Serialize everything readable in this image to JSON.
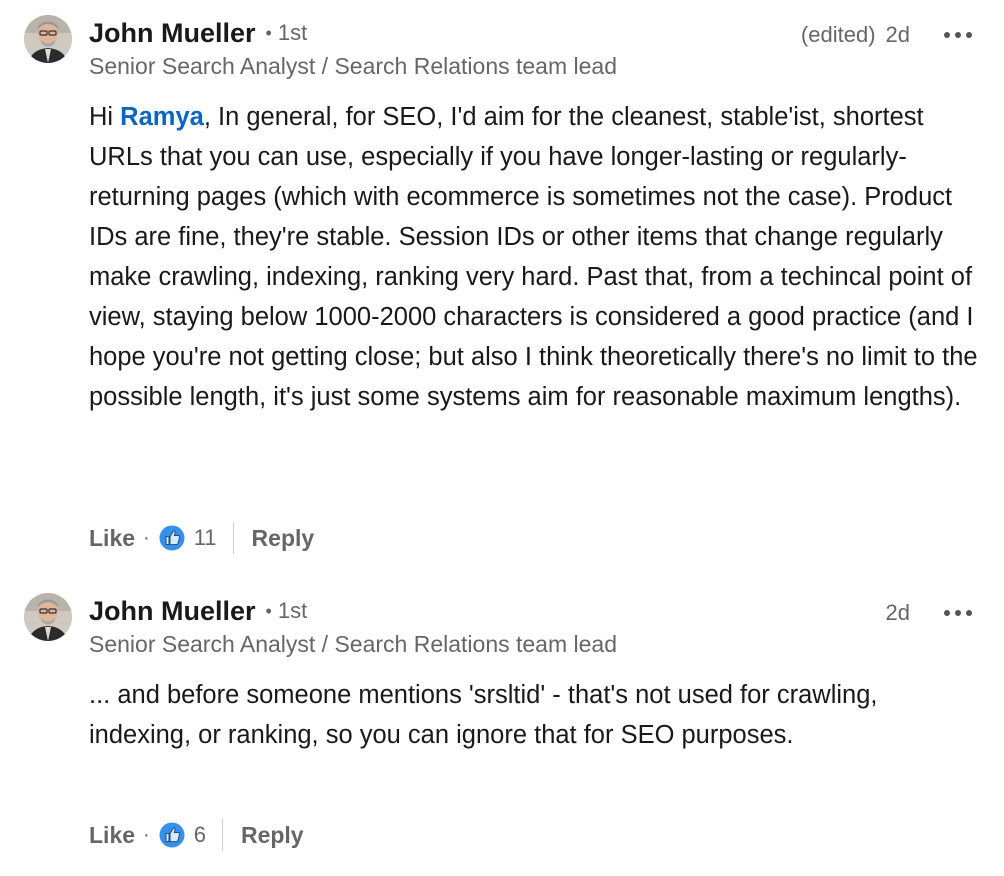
{
  "comments": [
    {
      "author": "John Mueller",
      "degree_dot": "•",
      "degree": "1st",
      "headline": "Senior Search Analyst / Search Relations team lead",
      "edited": "(edited)",
      "time": "2d",
      "mention": "Ramya",
      "greeting": "Hi ",
      "text_rest": ", In general, for SEO, I'd aim for the cleanest, stable'ist, shortest URLs that you can use, especially if you have longer-lasting or regularly-returning pages (which with ecommerce is sometimes not the case). Product IDs are fine, they're stable. Session IDs or other items that change regularly make crawling, indexing, ranking very hard. Past that, from a techincal point of view, staying below 1000-2000 characters is considered a good practice (and I hope you're not getting close; but also I think theoretically there's no limit to the possible length, it's just some systems aim for reasonable maximum lengths).",
      "like_label": "Like",
      "dot": "·",
      "reaction_count": "11",
      "reply_label": "Reply"
    },
    {
      "author": "John Mueller",
      "degree_dot": "•",
      "degree": "1st",
      "headline": "Senior Search Analyst / Search Relations team lead",
      "time": "2d",
      "text": "... and before someone mentions 'srsltid' - that's not used for crawling, indexing, or ranking, so you can ignore that for SEO purposes.",
      "like_label": "Like",
      "dot": "·",
      "reaction_count": "6",
      "reply_label": "Reply"
    }
  ],
  "icons": {
    "more": "more-options-icon",
    "reaction": "like-reaction-icon"
  },
  "colors": {
    "mention": "#0a66c2",
    "reaction_blue": "#378fe9",
    "muted": "#666666"
  }
}
